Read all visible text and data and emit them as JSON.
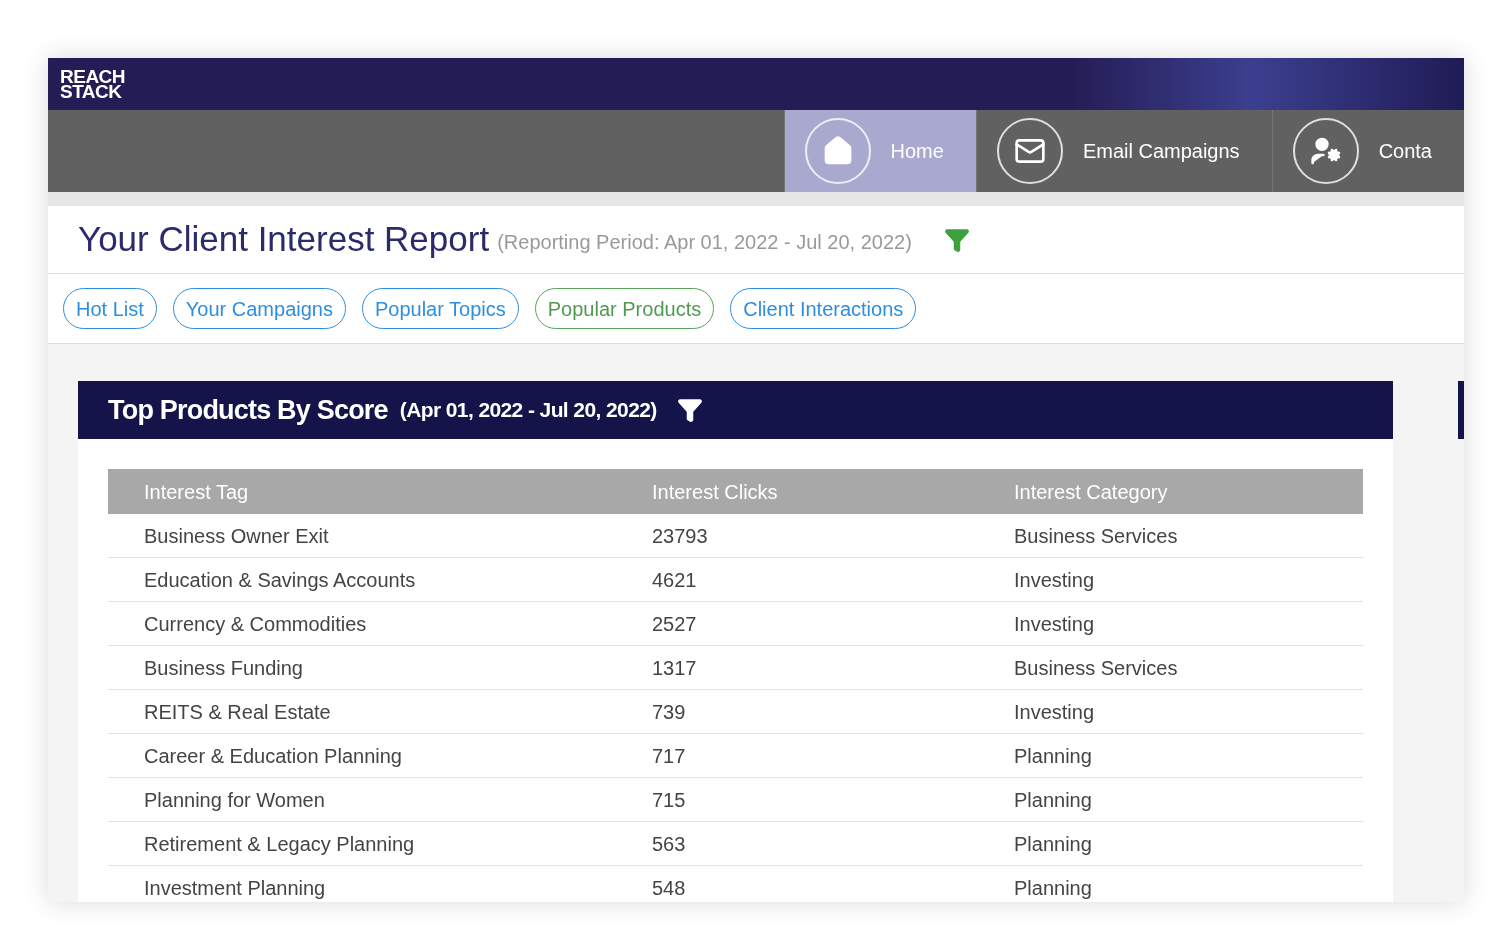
{
  "logo": {
    "lines": [
      "REACH",
      "STACK"
    ]
  },
  "nav": [
    {
      "label": "Home",
      "kind": "home",
      "selected": true
    },
    {
      "label": "Email Campaigns",
      "kind": "mail",
      "selected": false
    },
    {
      "label": "Conta",
      "kind": "contact",
      "selected": false
    }
  ],
  "report": {
    "title": "Your Client Interest Report",
    "period": "(Reporting Period: Apr 01, 2022 - Jul 20, 2022)"
  },
  "pills": [
    {
      "label": "Hot List",
      "selected": false
    },
    {
      "label": "Your Campaigns",
      "selected": false
    },
    {
      "label": "Popular Topics",
      "selected": false
    },
    {
      "label": "Popular Products",
      "selected": true
    },
    {
      "label": "Client Interactions",
      "selected": false
    }
  ],
  "card": {
    "title": "Top Products By Score",
    "period": "(Apr 01, 2022 - Jul 20, 2022)",
    "columns": [
      "Interest Tag",
      "Interest Clicks",
      "Interest Category"
    ],
    "rows": [
      [
        "Business Owner Exit",
        "23793",
        "Business Services"
      ],
      [
        "Education & Savings Accounts",
        "4621",
        "Investing"
      ],
      [
        "Currency & Commodities",
        "2527",
        "Investing"
      ],
      [
        "Business Funding",
        "1317",
        "Business Services"
      ],
      [
        "REITS & Real Estate",
        "739",
        "Investing"
      ],
      [
        "Career & Education Planning",
        "717",
        "Planning"
      ],
      [
        "Planning for Women",
        "715",
        "Planning"
      ],
      [
        "Retirement & Legacy Planning",
        "563",
        "Planning"
      ],
      [
        "Investment Planning",
        "548",
        "Planning"
      ]
    ]
  }
}
